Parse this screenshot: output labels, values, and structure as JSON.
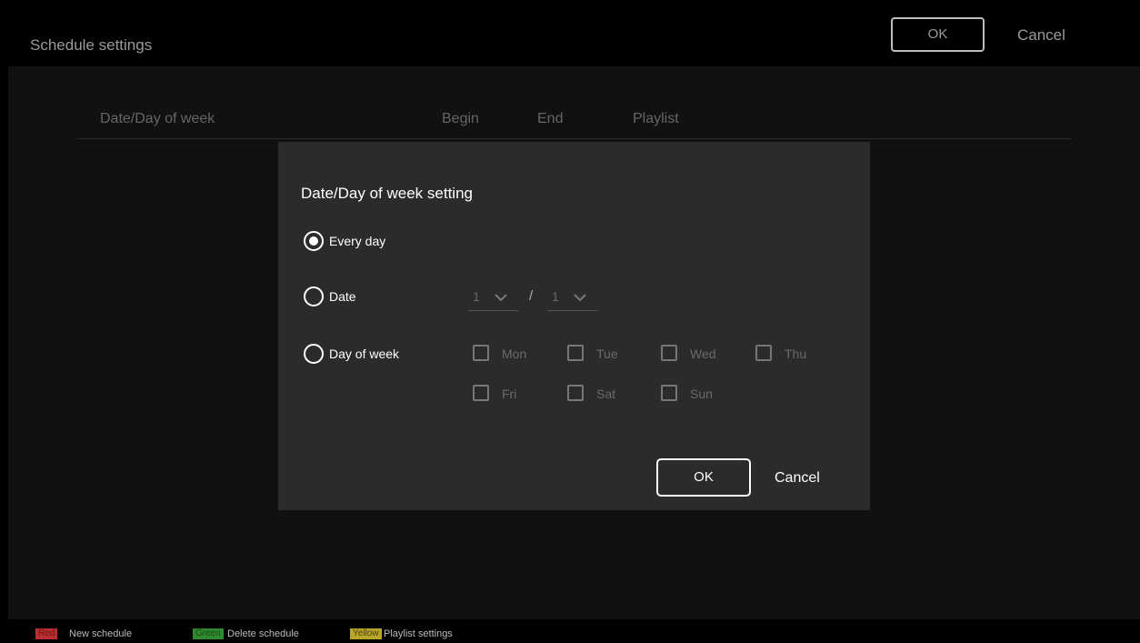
{
  "header": {
    "title": "Schedule settings",
    "ok_label": "OK",
    "cancel_label": "Cancel"
  },
  "table": {
    "columns": [
      "Date/Day of week",
      "Begin",
      "End",
      "Playlist"
    ]
  },
  "dialog": {
    "title": "Date/Day of week setting",
    "options": {
      "every_day": "Every day",
      "date": "Date",
      "day_of_week": "Day of week"
    },
    "selected_option": "every_day",
    "date_month": "1",
    "date_separator": "/",
    "date_day": "1",
    "days": [
      "Mon",
      "Tue",
      "Wed",
      "Thu",
      "Fri",
      "Sat",
      "Sun"
    ],
    "ok_label": "OK",
    "cancel_label": "Cancel"
  },
  "footer": {
    "red_key": "Red",
    "red_action": "New schedule",
    "green_key": "Green",
    "green_action": "Delete schedule",
    "yellow_key": "Yellow",
    "yellow_action": "Playlist settings"
  },
  "colors": {
    "red": "#b92e2e",
    "green": "#2f8a2f",
    "yellow": "#b9a52a"
  }
}
